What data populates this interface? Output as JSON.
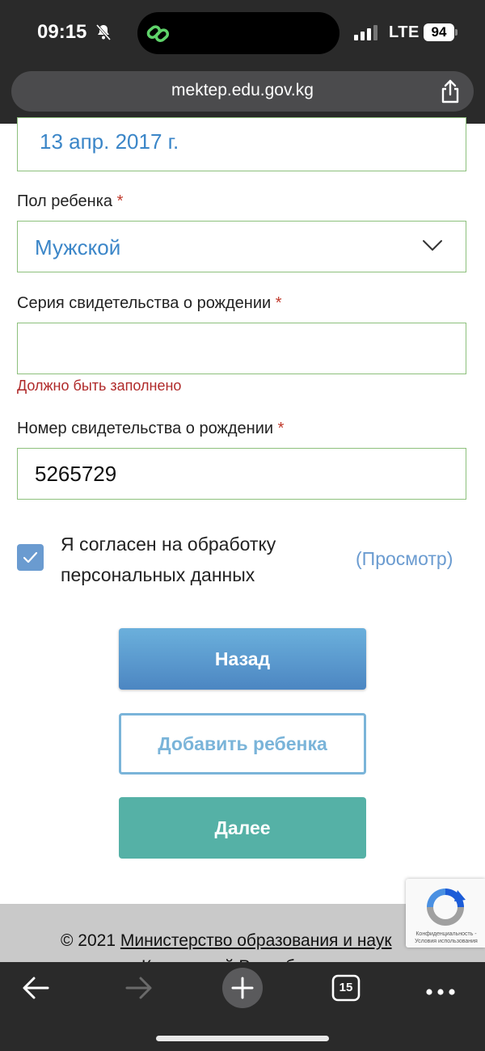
{
  "status_bar": {
    "time": "09:15",
    "network": "LTE",
    "battery": "94"
  },
  "browser": {
    "url": "mektep.edu.gov.kg",
    "tab_count": "15"
  },
  "form": {
    "birth_date_value": "13 апр. 2017 г.",
    "gender_label": "Пол ребенка",
    "gender_value": "Мужской",
    "cert_series_label": "Серия свидетельства о рождении",
    "cert_series_value": "",
    "cert_series_error": "Должно быть заполнено",
    "cert_number_label": "Номер свидетельства о рождении",
    "cert_number_value": "5265729",
    "required_mark": "*",
    "consent_checked": true,
    "consent_text": "Я согласен на обработку персональных данных",
    "view_link": "(Просмотр)"
  },
  "buttons": {
    "back": "Назад",
    "add_child": "Добавить ребенка",
    "next": "Далее"
  },
  "footer": {
    "copyright": "© 2021",
    "ministry_link": "Министерство образования и наук",
    "line2": "Кыргызской Республики"
  },
  "recaptcha": {
    "text": "Конфиденциальность - Условия использования"
  },
  "icons": {
    "bell": "bell-slash-icon",
    "link": "link-icon",
    "signal": "signal-icon",
    "share": "share-icon",
    "chevron": "chevron-down-icon",
    "check": "check-icon",
    "back": "arrow-left-icon",
    "forward": "arrow-right-icon",
    "new_tab": "plus-icon",
    "tabs": "tabs-icon",
    "more": "more-icon"
  },
  "colors": {
    "field_border": "#8dc07c",
    "value_blue": "#3b86c8",
    "error_red": "#b02a2a",
    "back_button": "#4c86c2",
    "next_button": "#55b1a6",
    "add_button_border": "#7ab4d9"
  }
}
